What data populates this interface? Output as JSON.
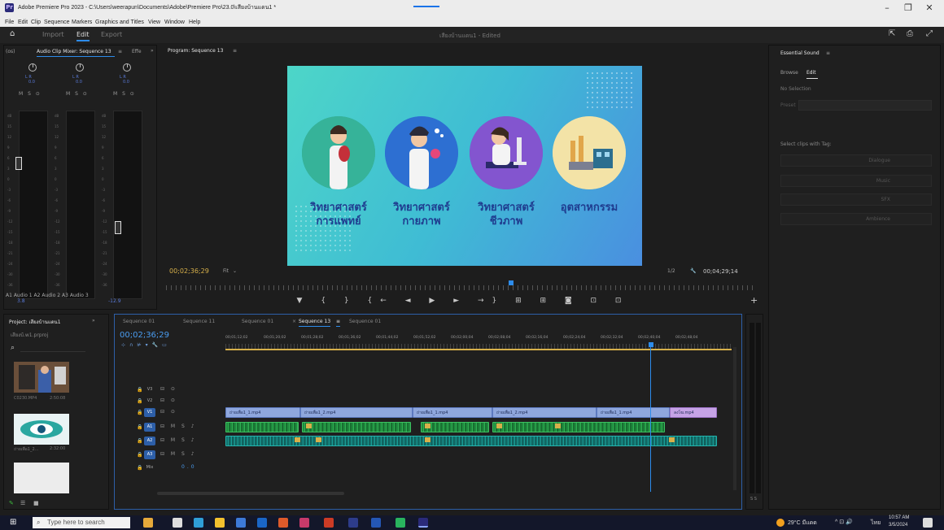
{
  "window": {
    "title": "Adobe Premiere Pro 2023 - C:\\Users\\weerapun\\Documents\\Adobe\\Premiere Pro\\23.0\\เสียงบ้านแดน1 *",
    "app_icon": "Pr"
  },
  "menu": [
    "File",
    "Edit",
    "Clip",
    "Sequence",
    "Markers",
    "Graphics and Titles",
    "View",
    "Window",
    "Help"
  ],
  "workspace": {
    "tabs": [
      "Import",
      "Edit",
      "Export"
    ],
    "active": "Edit",
    "project_title": "เสียงบ้านแดน1 - Edited"
  },
  "mixer": {
    "tabs": [
      "(os)",
      "Audio Clip Mixer: Sequence 13",
      "Effe"
    ],
    "menu_glyph": "≡",
    "more_glyph": "»",
    "channel_lr": "L  R",
    "channel_zero": "0.0",
    "msr": "M S ⊙",
    "scale": [
      "dB",
      "15",
      "12",
      "9",
      "6",
      "3",
      "0",
      "-3",
      "-6",
      "-9",
      "-12",
      "-15",
      "-18",
      "-21",
      "-24",
      "-30",
      "-36",
      "-42"
    ],
    "value_a1": "3.8",
    "value_a3": "-12.9",
    "channel_labels": "A1  Audio 1  A2  Audio 2  A3  Audio 3"
  },
  "program": {
    "title": "Program: Sequence 13",
    "menu_glyph": "≡",
    "timecode_left": "00;02;36;29",
    "fit_label": "Fit",
    "quality_label": "1/2",
    "timecode_right": "00;04;29;14",
    "transport": "▼ { } {← ◄ ▶ ► →} ⊞ ⊞ ◙ ⊡ ⊡",
    "plus": "+",
    "slides": [
      {
        "label_line1": "วิทยาศาสตร์",
        "label_line2": "การแพทย์"
      },
      {
        "label_line1": "วิทยาศาสตร์",
        "label_line2": "กายภาพ"
      },
      {
        "label_line1": "วิทยาศาสตร์",
        "label_line2": "ชีวภาพ"
      },
      {
        "label_line1": "อุตสาหกรรม",
        "label_line2": ""
      }
    ]
  },
  "essential": {
    "title": "Essential Sound",
    "menu_glyph": "≡",
    "tabs": [
      "Browse",
      "Edit"
    ],
    "no_selection": "No Selection",
    "preset_label": "Preset",
    "select_clips": "Select clips with Tag:",
    "buttons": [
      "Dialogue",
      "Music",
      "SFX",
      "Ambience"
    ]
  },
  "project": {
    "title": "Project: เสียงบ้านแดน1",
    "file": "เสียงบ้.w1.prproj",
    "search_icon": "⌕",
    "items": [
      {
        "name": "C0230.MP4",
        "duration": "2:50:08"
      },
      {
        "name": "ถ่ายเพื่อ1_2...",
        "duration": "2:32:00"
      },
      {
        "name": "",
        "duration": ""
      }
    ]
  },
  "tools": [
    "▶",
    "⇹",
    "⇻",
    "◆",
    "|↔|",
    "✒",
    "▭",
    "✋",
    "T"
  ],
  "timeline": {
    "tabs": [
      "Sequence 01",
      "Sequence 11",
      "Sequence 01",
      "Sequence 13",
      "Sequence 01"
    ],
    "active_tab": "Sequence 13",
    "close_glyph": "×",
    "timecode": "00;02;36;29",
    "ruler_labels": [
      "00;01;12;02",
      "00;01;20;02",
      "00;01;28;02",
      "00;01;36;02",
      "00;01;44;02",
      "00;01;52;02",
      "00;02;00;04",
      "00;02;08;04",
      "00;02;16;04",
      "00;02;24;04",
      "00;02;32;04",
      "00;02;40;04",
      "00;02;48;04"
    ],
    "tracks": [
      {
        "name": "V3",
        "controls": "⊟ ⊙",
        "active": false
      },
      {
        "name": "V2",
        "controls": "⊟ ⊙",
        "active": false
      },
      {
        "name": "V1",
        "controls": "⊟ ⊙",
        "active": true
      },
      {
        "name": "A1",
        "controls": "⊟ M S ♪",
        "active": true
      },
      {
        "name": "A2",
        "controls": "⊟ M S ♪",
        "active": true
      },
      {
        "name": "A3",
        "controls": "⊟ M S ♪",
        "active": true
      }
    ],
    "mix": {
      "name": "Mix",
      "value": "0.0"
    },
    "video_clips": [
      {
        "label": "ถ่ายเพื่อ1_1.mp4"
      },
      {
        "label": "ถ่ายเพื่อ1_2.mp4"
      },
      {
        "label": "ถ่ายเพื่อ1_1.mp4"
      },
      {
        "label": "ถ่ายเพื่อ1_2.mp4"
      },
      {
        "label": "ถ่ายเพื่อ1_1.mp4"
      },
      {
        "label": "ลงโฆ.mp4"
      }
    ],
    "meter_label": "S S"
  },
  "taskbar": {
    "search_placeholder": "Type here to search",
    "weather": "29°C มีแดด",
    "lang": "ไทย",
    "time": "10:57 AM",
    "date": "3/5/2024"
  },
  "colors": {
    "accent": "#2d8ceb",
    "timecode": "#d7b04a",
    "audio_clip": "#2fb052",
    "audio_clip_2": "#1aa19a",
    "video_clip": "#8fa7dd",
    "slide_text": "#1f3c8f"
  }
}
